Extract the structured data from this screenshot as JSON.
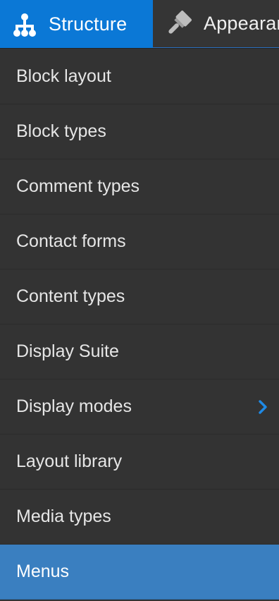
{
  "toolbar": {
    "tabs": [
      {
        "label": "Structure",
        "icon": "sitemap-icon"
      },
      {
        "label": "Appearance",
        "icon": "paint-brush-icon"
      }
    ]
  },
  "menu": {
    "items": [
      {
        "label": "Block layout"
      },
      {
        "label": "Block types"
      },
      {
        "label": "Comment types"
      },
      {
        "label": "Contact forms"
      },
      {
        "label": "Content types"
      },
      {
        "label": "Display Suite"
      },
      {
        "label": "Display modes",
        "has_submenu": true
      },
      {
        "label": "Layout library"
      },
      {
        "label": "Media types"
      },
      {
        "label": "Menus",
        "active": true
      }
    ]
  },
  "colors": {
    "accent": "#0b78d6",
    "active_item": "#3a7fc0",
    "menu_background": "#333333",
    "chevron": "#1e8ae6"
  }
}
